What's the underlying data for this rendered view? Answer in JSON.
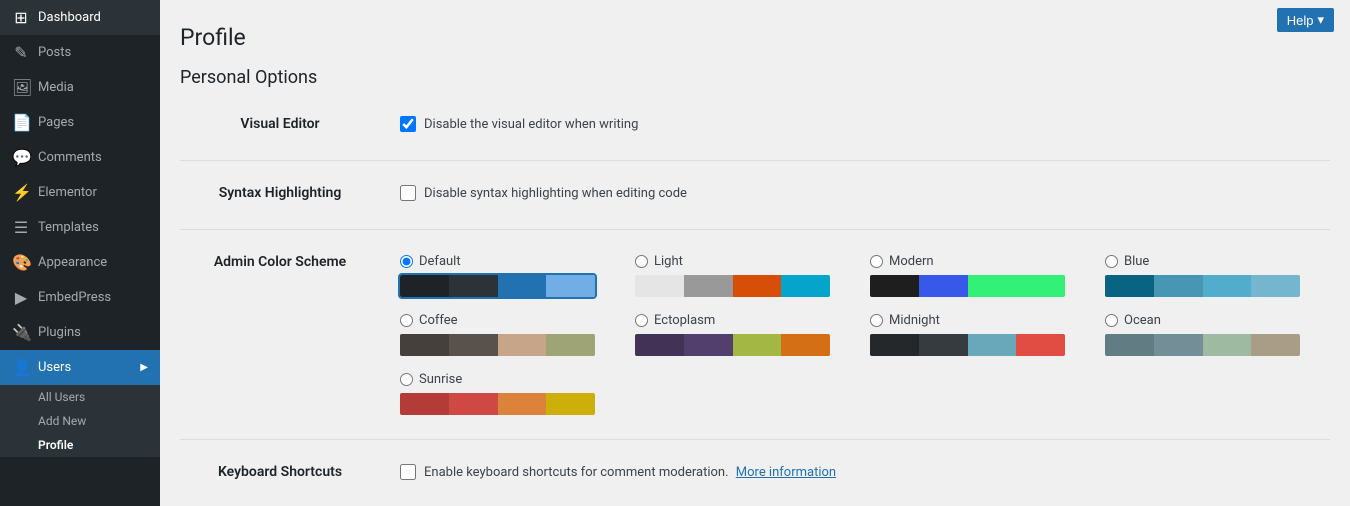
{
  "page": {
    "title": "Profile"
  },
  "help_button": {
    "label": "Help",
    "chevron": "▾"
  },
  "sidebar": {
    "items": [
      {
        "id": "dashboard",
        "icon": "⊞",
        "label": "Dashboard"
      },
      {
        "id": "posts",
        "icon": "✎",
        "label": "Posts"
      },
      {
        "id": "media",
        "icon": "🖼",
        "label": "Media"
      },
      {
        "id": "pages",
        "icon": "📄",
        "label": "Pages"
      },
      {
        "id": "comments",
        "icon": "💬",
        "label": "Comments"
      },
      {
        "id": "elementor",
        "icon": "⚡",
        "label": "Elementor"
      },
      {
        "id": "templates",
        "icon": "☰",
        "label": "Templates"
      },
      {
        "id": "appearance",
        "icon": "🎨",
        "label": "Appearance"
      },
      {
        "id": "embedpress",
        "icon": "▶",
        "label": "EmbedPress"
      },
      {
        "id": "plugins",
        "icon": "🔌",
        "label": "Plugins"
      },
      {
        "id": "users",
        "icon": "👤",
        "label": "Users",
        "active": true
      }
    ],
    "sub_items": [
      {
        "id": "all-users",
        "label": "All Users"
      },
      {
        "id": "add-new",
        "label": "Add New"
      },
      {
        "id": "profile",
        "label": "Profile",
        "active": true
      }
    ]
  },
  "sections": {
    "personal_options": {
      "title": "Personal Options",
      "visual_editor": {
        "label": "Visual Editor",
        "checkbox_label": "Disable the visual editor when writing",
        "checked": true
      },
      "syntax_highlighting": {
        "label": "Syntax Highlighting",
        "checkbox_label": "Disable syntax highlighting when editing code",
        "checked": false
      },
      "admin_color_scheme": {
        "label": "Admin Color Scheme",
        "schemes": [
          {
            "id": "default",
            "label": "Default",
            "selected": true,
            "colors": [
              "#1d2327",
              "#2c3338",
              "#2271b1",
              "#72aee6"
            ]
          },
          {
            "id": "light",
            "label": "Light",
            "selected": false,
            "colors": [
              "#e5e5e5",
              "#999",
              "#d64e07",
              "#04a4cc"
            ]
          },
          {
            "id": "modern",
            "label": "Modern",
            "selected": false,
            "colors": [
              "#1e1e1e",
              "#3858e9",
              "#33f078",
              "#33f078"
            ]
          },
          {
            "id": "blue",
            "label": "Blue",
            "selected": false,
            "colors": [
              "#096484",
              "#4796b3",
              "#52accc",
              "#74B6CE"
            ]
          },
          {
            "id": "coffee",
            "label": "Coffee",
            "selected": false,
            "colors": [
              "#46403c",
              "#59524c",
              "#c7a589",
              "#9ea476"
            ]
          },
          {
            "id": "ectoplasm",
            "label": "Ectoplasm",
            "selected": false,
            "colors": [
              "#413256",
              "#523f6d",
              "#a3b745",
              "#d46f15"
            ]
          },
          {
            "id": "midnight",
            "label": "Midnight",
            "selected": false,
            "colors": [
              "#25282b",
              "#363b3f",
              "#69a8bb",
              "#e14d43"
            ]
          },
          {
            "id": "ocean",
            "label": "Ocean",
            "selected": false,
            "colors": [
              "#627c83",
              "#738e96",
              "#9ebaa0",
              "#aa9d88"
            ]
          },
          {
            "id": "sunrise",
            "label": "Sunrise",
            "selected": false,
            "colors": [
              "#b43c38",
              "#cf4944",
              "#dd823b",
              "#ccaf0b"
            ]
          }
        ]
      },
      "keyboard_shortcuts": {
        "label": "Keyboard Shortcuts",
        "checkbox_label": "Enable keyboard shortcuts for comment moderation.",
        "link_label": "More information",
        "checked": false
      }
    }
  }
}
